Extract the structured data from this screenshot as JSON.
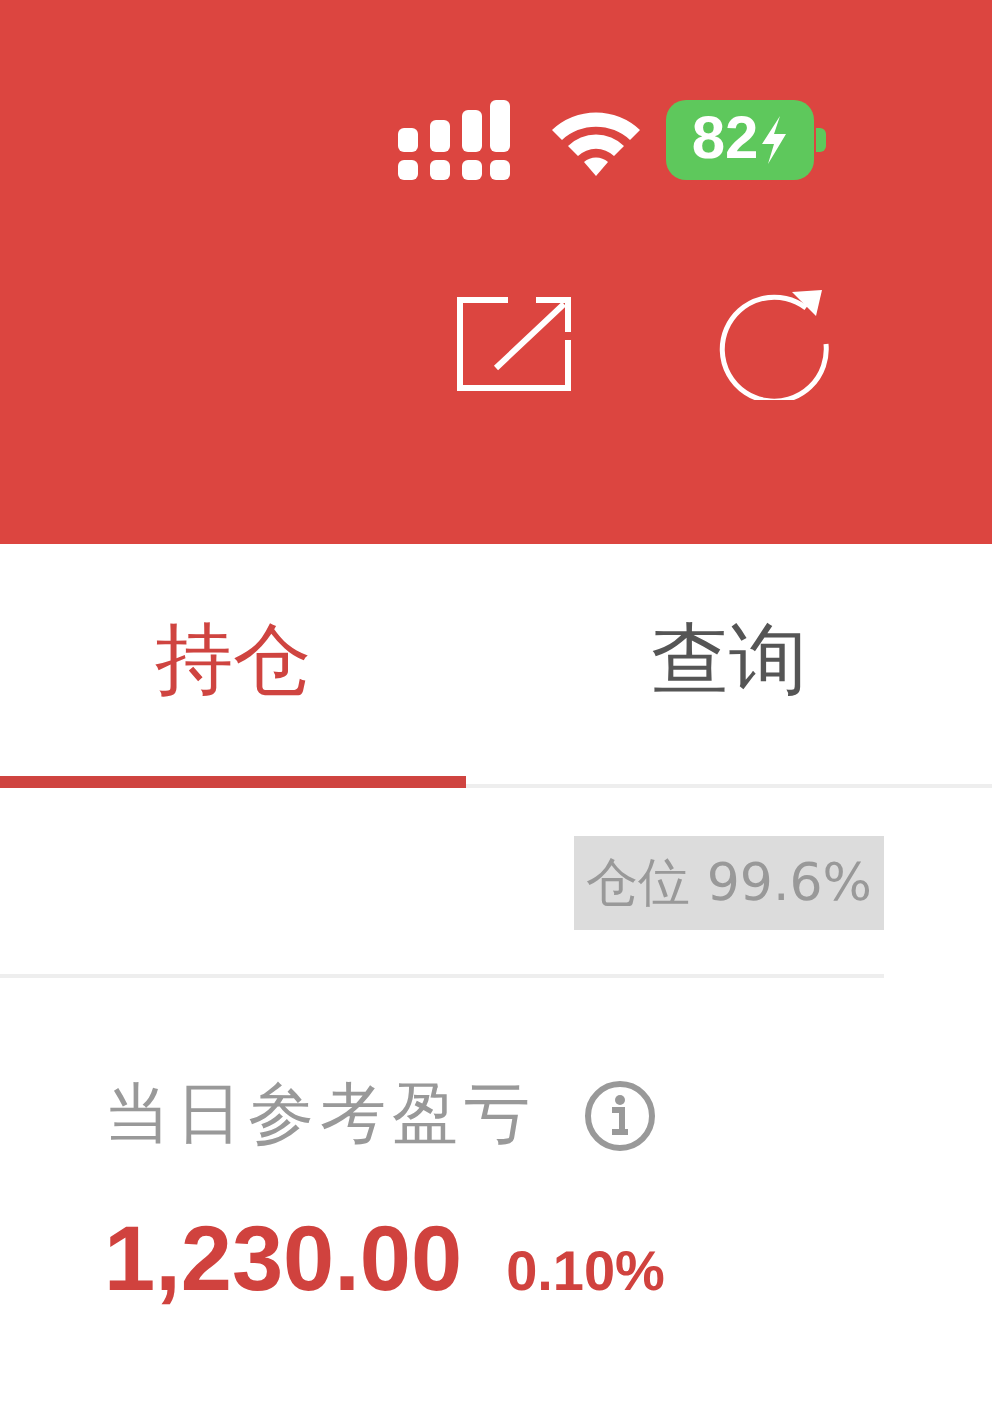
{
  "status_bar": {
    "battery": "82",
    "charging": true
  },
  "tabs": [
    {
      "label": "持仓",
      "selected": true
    },
    {
      "label": "查询",
      "selected": false
    }
  ],
  "position_badge": "仓位 99.6%",
  "summary": {
    "label": "当日参考盈亏",
    "value": "1,230.00",
    "percent": "0.10%"
  }
}
